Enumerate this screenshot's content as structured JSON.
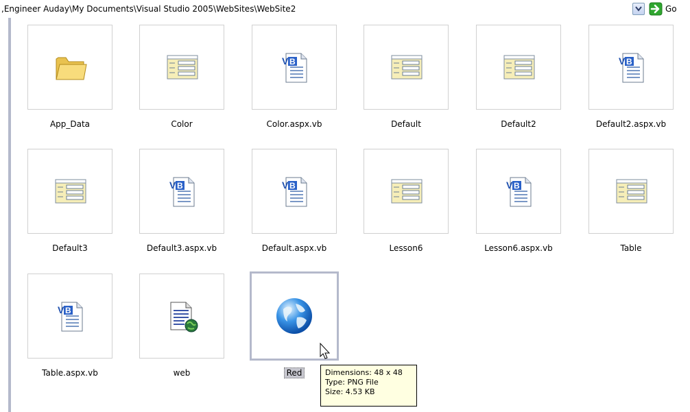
{
  "address_bar": {
    "path": ",Engineer Auday\\My Documents\\Visual Studio 2005\\WebSites\\WebSite2",
    "go_label": "Go"
  },
  "items": [
    {
      "label": "App_Data",
      "icon": "folder-icon"
    },
    {
      "label": "Color",
      "icon": "aspx-file-icon"
    },
    {
      "label": "Color.aspx.vb",
      "icon": "vb-file-icon"
    },
    {
      "label": "Default",
      "icon": "aspx-file-icon"
    },
    {
      "label": "Default2",
      "icon": "aspx-file-icon"
    },
    {
      "label": "Default2.aspx.vb",
      "icon": "vb-file-icon"
    },
    {
      "label": "Default3",
      "icon": "aspx-file-icon"
    },
    {
      "label": "Default3.aspx.vb",
      "icon": "vb-file-icon"
    },
    {
      "label": "Default.aspx.vb",
      "icon": "vb-file-icon"
    },
    {
      "label": "Lesson6",
      "icon": "aspx-file-icon"
    },
    {
      "label": "Lesson6.aspx.vb",
      "icon": "vb-file-icon"
    },
    {
      "label": "Table",
      "icon": "aspx-file-icon"
    },
    {
      "label": "Table.aspx.vb",
      "icon": "vb-file-icon"
    },
    {
      "label": "web",
      "icon": "web-config-icon"
    },
    {
      "label": "Red",
      "icon": "globe-image-icon",
      "selected": true
    }
  ],
  "tooltip": {
    "dimensions": "Dimensions: 48 x 48",
    "type": "Type: PNG File",
    "size": "Size: 4.53 KB"
  },
  "colors": {
    "selection_border": "#b4b9cb",
    "tooltip_bg": "#ffffe1",
    "folder": "#f3d36e",
    "go_green": "#2fa62f"
  }
}
